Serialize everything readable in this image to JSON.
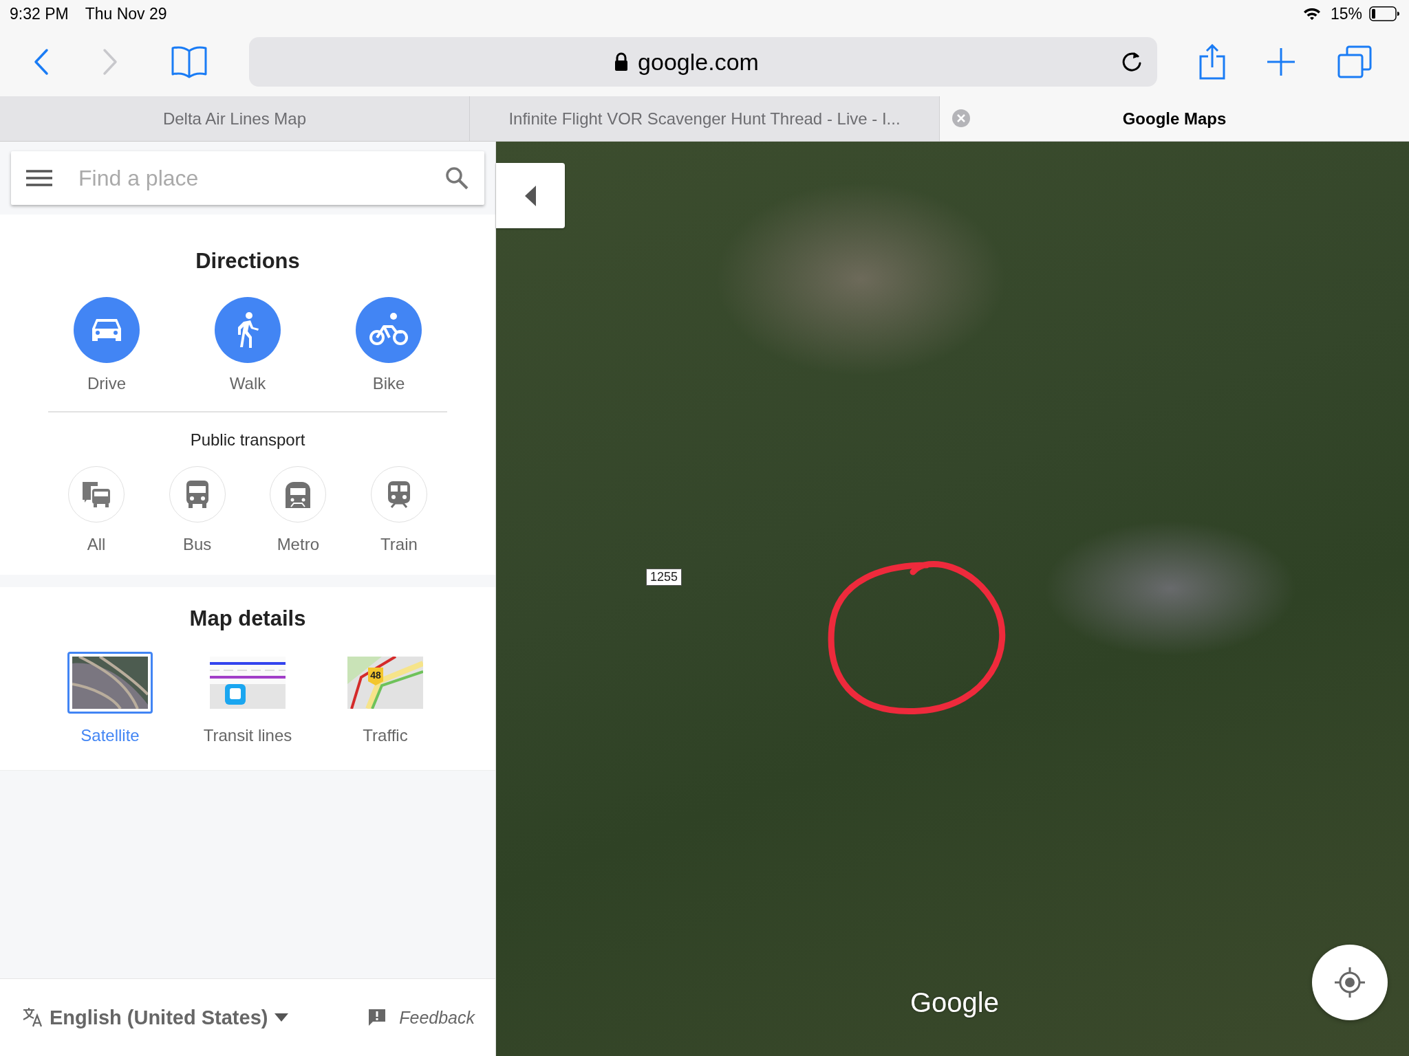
{
  "status_bar": {
    "time": "9:32 PM",
    "date": "Thu Nov 29",
    "battery": "15%"
  },
  "browser": {
    "url": "google.com",
    "tabs": [
      {
        "title": "Delta Air Lines Map",
        "selected": false
      },
      {
        "title": "Infinite Flight VOR Scavenger Hunt Thread - Live - I...",
        "selected": false
      },
      {
        "title": "Google Maps",
        "selected": true
      }
    ]
  },
  "search": {
    "placeholder": "Find a place"
  },
  "directions": {
    "title": "Directions",
    "modes": [
      {
        "label": "Drive",
        "kind": "car"
      },
      {
        "label": "Walk",
        "kind": "walk"
      },
      {
        "label": "Bike",
        "kind": "bike"
      }
    ],
    "transit_title": "Public transport",
    "transit": [
      {
        "label": "All",
        "kind": "all"
      },
      {
        "label": "Bus",
        "kind": "bus"
      },
      {
        "label": "Metro",
        "kind": "metro"
      },
      {
        "label": "Train",
        "kind": "train"
      }
    ]
  },
  "map_details": {
    "title": "Map details",
    "layers": [
      {
        "label": "Satellite",
        "kind": "satellite",
        "selected": true
      },
      {
        "label": "Transit lines",
        "kind": "transit",
        "selected": false
      },
      {
        "label": "Traffic",
        "kind": "traffic",
        "selected": false,
        "badge": "48"
      }
    ]
  },
  "footer": {
    "language": "English (United States)",
    "feedback": "Feedback"
  },
  "map": {
    "road_label": "1255",
    "logo": "Google"
  }
}
